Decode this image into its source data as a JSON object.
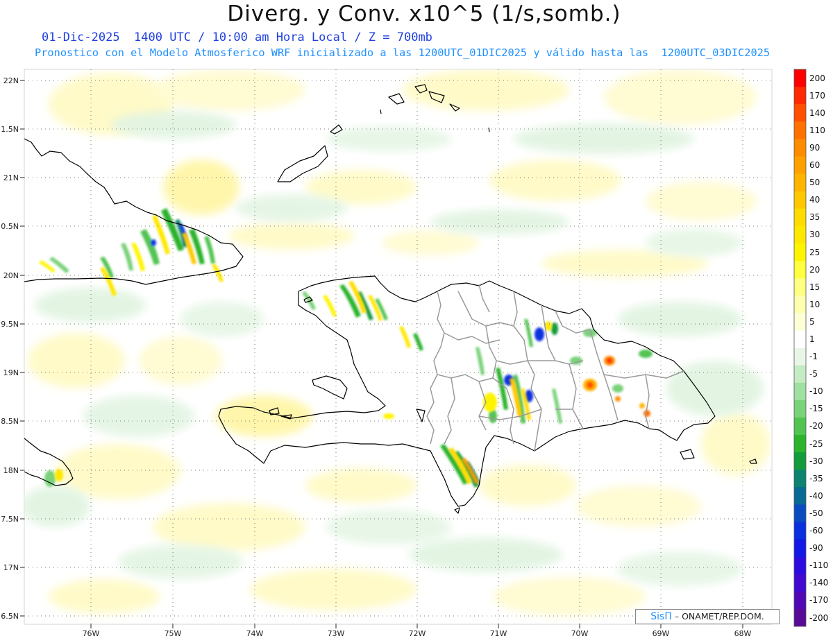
{
  "header": {
    "title": "Diverg. y Conv. x10^5 (1/s,somb.)",
    "subtitle_line1": "01-Dic-2025  1400 UTC / 10:00 am Hora Local / Z = 700mb",
    "subtitle_line2": "Pronostico con el Modelo Atmosferico WRF inicializado a las 1200UTC_01DIC2025 y válido hasta las  1200UTC_03DIC2025"
  },
  "axes": {
    "lat_labels": [
      "22N",
      "1.5N",
      "21N",
      "0.5N",
      "20N",
      "9.5N",
      "19N",
      "8.5N",
      "18N",
      "7.5N",
      "17N",
      "6.5N"
    ],
    "lon_labels": [
      "76W",
      "75W",
      "74W",
      "73W",
      "72W",
      "71W",
      "70W",
      "69W",
      "68W"
    ]
  },
  "colorbar": {
    "labels": [
      "200",
      "170",
      "140",
      "110",
      "90",
      "60",
      "50",
      "40",
      "35",
      "30",
      "25",
      "20",
      "15",
      "10",
      "5",
      "1",
      "-1",
      "-5",
      "-10",
      "-15",
      "-20",
      "-25",
      "-30",
      "-35",
      "-40",
      "-50",
      "-60",
      "-90",
      "-110",
      "-140",
      "-170",
      "-200"
    ],
    "colors": [
      "#ff0000",
      "#ff2a00",
      "#ff5000",
      "#ff7000",
      "#ff8c00",
      "#ffa000",
      "#ffb400",
      "#ffc800",
      "#ffdc00",
      "#ffe800",
      "#fff400",
      "#ffff40",
      "#ffff80",
      "#ffffb0",
      "#ffffd6",
      "#ffffff",
      "#e8f6e8",
      "#c4ecc4",
      "#a0e0a0",
      "#7ad27a",
      "#52c452",
      "#2cb42c",
      "#129c3c",
      "#0c8470",
      "#0a6a96",
      "#0a4cc0",
      "#0a30e0",
      "#1418e6",
      "#2c0ce0",
      "#420ad0",
      "#5008b4",
      "#580a98"
    ]
  },
  "credit": {
    "sis": "SisΠ",
    "text": "– ONAMET/REP.DOM."
  },
  "colors": {
    "land_outline": "#000000",
    "province_lines": "#9a9a9a",
    "grid": "#777777",
    "div_light": "#fffac8",
    "conv_light": "#e4f5e4"
  }
}
